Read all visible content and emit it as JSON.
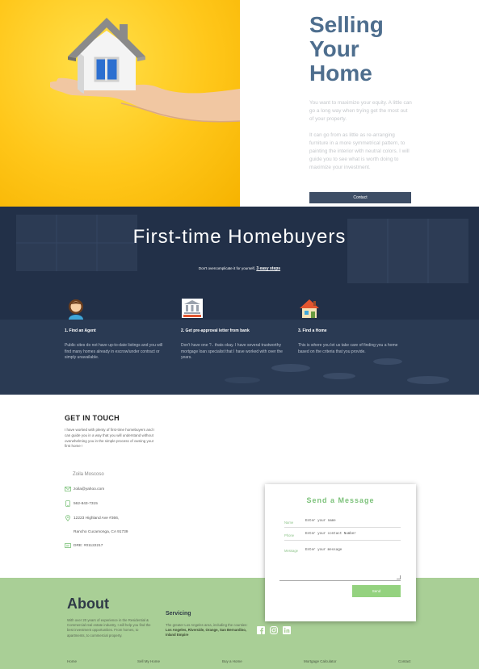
{
  "hero": {
    "title_lines": [
      "Selling",
      "Your",
      "Home"
    ],
    "paragraph1": "You want to maximize your equity. A little can go a long way when trying get the most out of your property.",
    "paragraph2": "It can go from as little as re-arranging furniture in a more symmetrical pattern, to painting the interior with neutral colors. I will guide you to see what is worth doing to maximize your investment.",
    "contact_button": "Contact"
  },
  "homebuyers": {
    "title": "First-time Homebuyers",
    "subtitle_prefix": "Don't overcomplicate it for yourself,",
    "subtitle_steps": "3 easy steps",
    "steps": [
      {
        "icon": "agent-icon",
        "title": "1. Find an Agent",
        "desc": "Public sites do not have up-to-date listings and you will find many homes already in escrow/under contract or simply unavailable."
      },
      {
        "icon": "bank-icon",
        "title": "2. Get pre-approval letter from bank",
        "desc": "Don't have one ?.. thats okay. I have several trustworthy mortgage loan specialist that I have worked with over the years."
      },
      {
        "icon": "home-icon",
        "title": "3. Find a Home",
        "desc": "This is where you let us take care of finding you a home based on the criteria that you provide."
      }
    ]
  },
  "touch": {
    "title": "GET IN TOUCH",
    "desc": "I have worked with plenty of first-time homebuyers and I can guide you in a way that you will understand without overwhelming you in the simple process of owning your first home !",
    "name": "Zoila Moscoso",
    "email": "zoila@yahoo.com",
    "phone": "562-843-7315",
    "address1": "12223 Highland Ave #366,",
    "address2": "Rancho Cucamonga, CA 91739",
    "dre": "DRE: #01122217"
  },
  "form": {
    "title": "Send a Message",
    "name_label": "Name",
    "name_placeholder": "Enter your name",
    "phone_label": "Phone",
    "phone_placeholder": "Enter your contact Number",
    "message_label": "Message",
    "message_placeholder": "Enter your message",
    "send_button": "Send"
  },
  "footer": {
    "about_title": "About",
    "about_text": "With over 20 years of experience in the Residential & Commercial real estate industry, I will help you find the best investment opportunities. From homes, to apartments, to commercial property.",
    "servicing_title": "Servicing",
    "servicing_prefix": "The greater Los Angeles area, including the counties:",
    "servicing_counties": "Los Angeles, Riverside, Orange, San Bernardino, Inland Empire",
    "social_icons": [
      "facebook-icon",
      "instagram-icon",
      "linkedin-icon"
    ],
    "nav": [
      "Home",
      "Sell My Home",
      "Buy a Home",
      "Mortgage Calculator",
      "Contact"
    ]
  },
  "colors": {
    "hero_yellow": "#ffc71a",
    "title_blue": "#4e6e8e",
    "button_navy": "#3e4e66",
    "footer_green": "#a9cf96",
    "form_green": "#7cc27a",
    "send_green": "#94d27f"
  }
}
